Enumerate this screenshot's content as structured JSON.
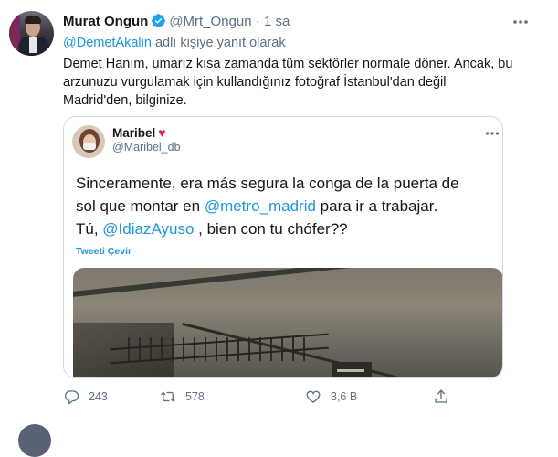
{
  "tweet": {
    "author_name": "Murat Ongun",
    "author_handle": "@Mrt_Ongun",
    "separator": "·",
    "time": "1 sa",
    "reply_mention": "@DemetAkalin",
    "reply_suffix": " adlı kişiye yanıt olarak",
    "text": "Demet Hanım, umarız kısa zamanda tüm sektörler normale döner. Ancak, bu\narzunuzu vurgulamak için kullandığınız fotoğraf İstanbul'dan değil\nMadrid'den, bilginize.",
    "quote": {
      "author_name": "Maribel",
      "heart": "♥",
      "author_handle": "@Maribel_db",
      "line1": "Sinceramente, era más segura la conga de la puerta de",
      "line2_pre": "sol que montar en ",
      "line2_mention": "@metro_madrid",
      "line2_post": " para ir a trabajar.",
      "line3_pre": "Tú, ",
      "line3_mention": "@IdiazAyuso",
      "line3_post": " , bien con tu chófer??",
      "translate_label": "Tweeti Çevir"
    },
    "actions": {
      "reply_count": "243",
      "retweet_count": "578",
      "like_count": "3,6 B"
    }
  },
  "colors": {
    "accent": "#1b95e0",
    "secondary_text": "#5b7083",
    "heart": "#e0245e"
  },
  "icons": [
    "verified-badge-icon",
    "more-options-icon",
    "reply-icon",
    "retweet-icon",
    "like-icon",
    "share-icon"
  ]
}
